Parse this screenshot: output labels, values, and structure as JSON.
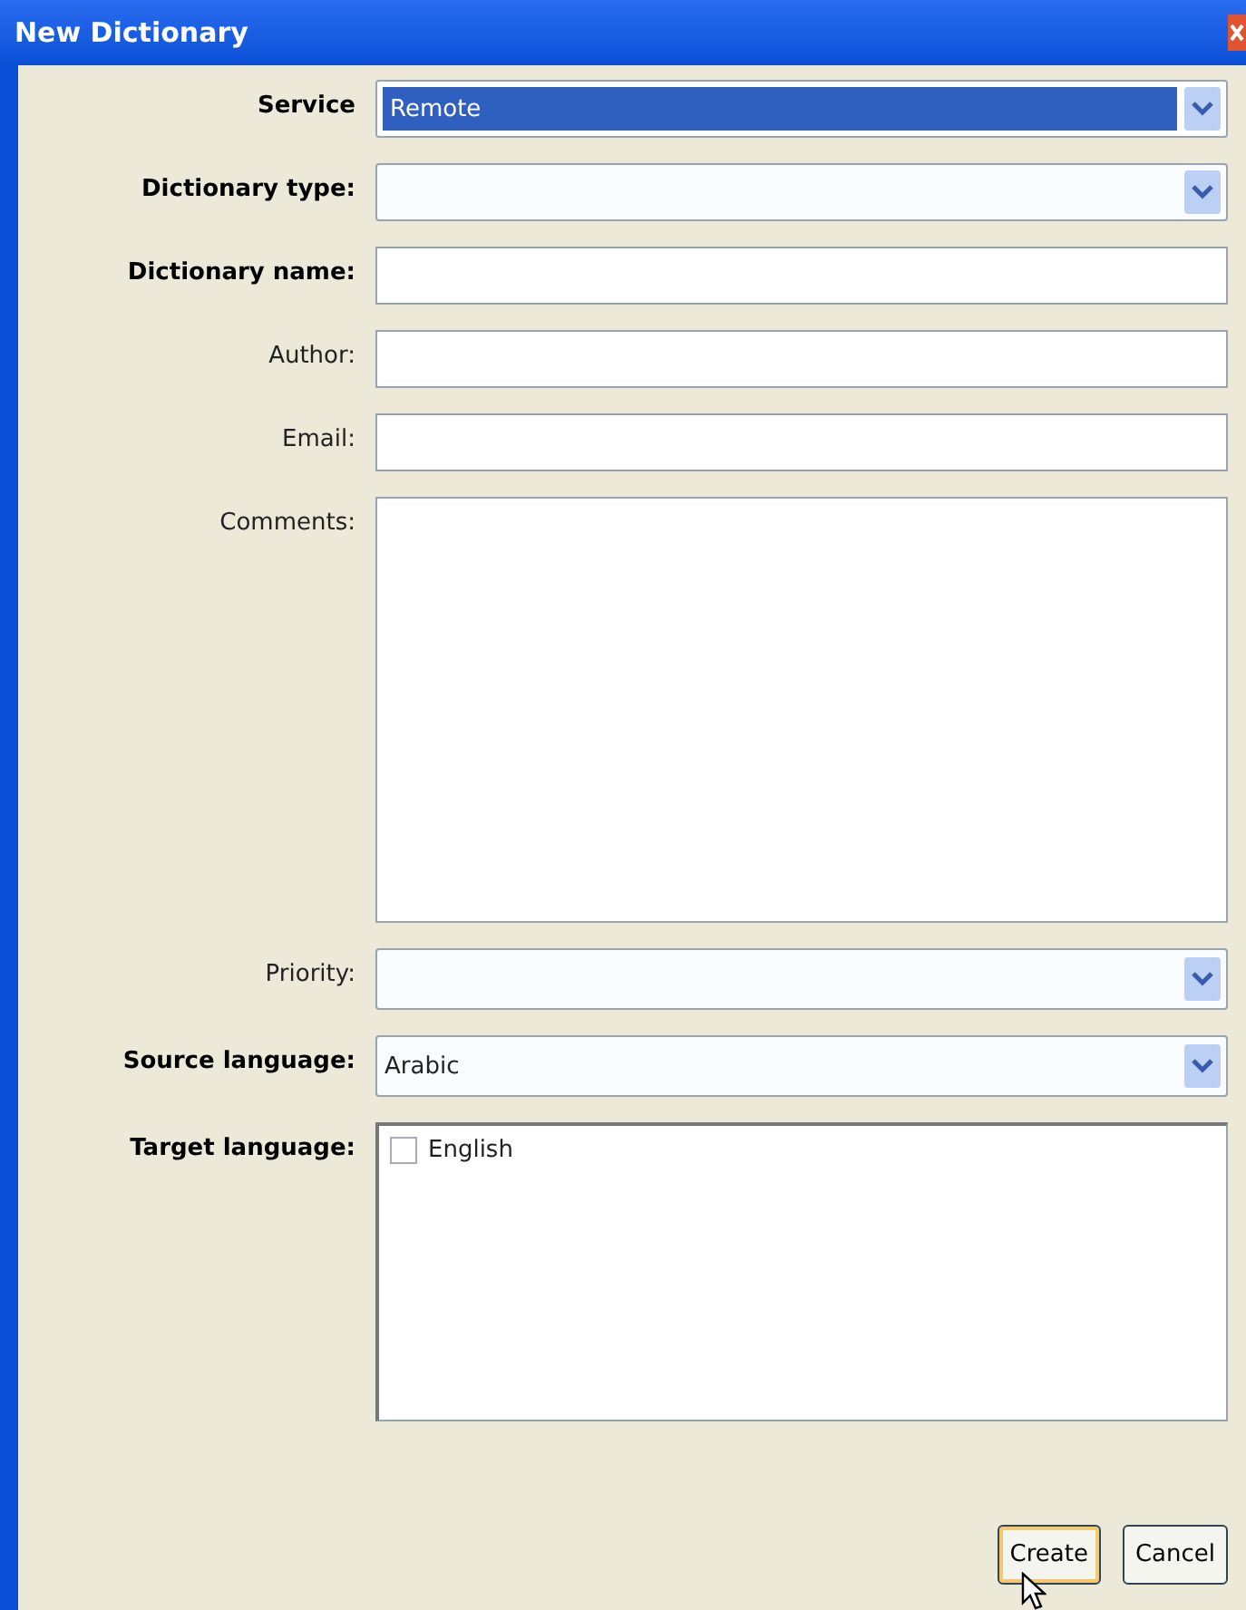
{
  "window": {
    "title": "New Dictionary"
  },
  "fields": [
    {
      "label": "Service",
      "required": true,
      "kind": "dropdown",
      "value": "Remote",
      "highlighted": true
    },
    {
      "label": "Dictionary type:",
      "required": true,
      "kind": "dropdown",
      "highlighted": false
    },
    {
      "label": "Dictionary name:",
      "required": true,
      "kind": "text"
    },
    {
      "label": "Author:",
      "required": false,
      "kind": "text"
    },
    {
      "label": "Email:",
      "required": false,
      "kind": "text"
    },
    {
      "label": "Comments:",
      "required": false,
      "kind": "textarea"
    },
    {
      "label": "Priority:",
      "required": false,
      "kind": "dropdown",
      "highlighted": false
    },
    {
      "label": "Source language:",
      "required": true,
      "kind": "dropdown",
      "value": "Arabic",
      "highlighted": false
    },
    {
      "label": "Target language:",
      "required": true,
      "kind": "checklist",
      "options": [
        {
          "label": "English",
          "checked": false
        }
      ]
    }
  ],
  "buttons": [
    "Create",
    "Cancel"
  ]
}
